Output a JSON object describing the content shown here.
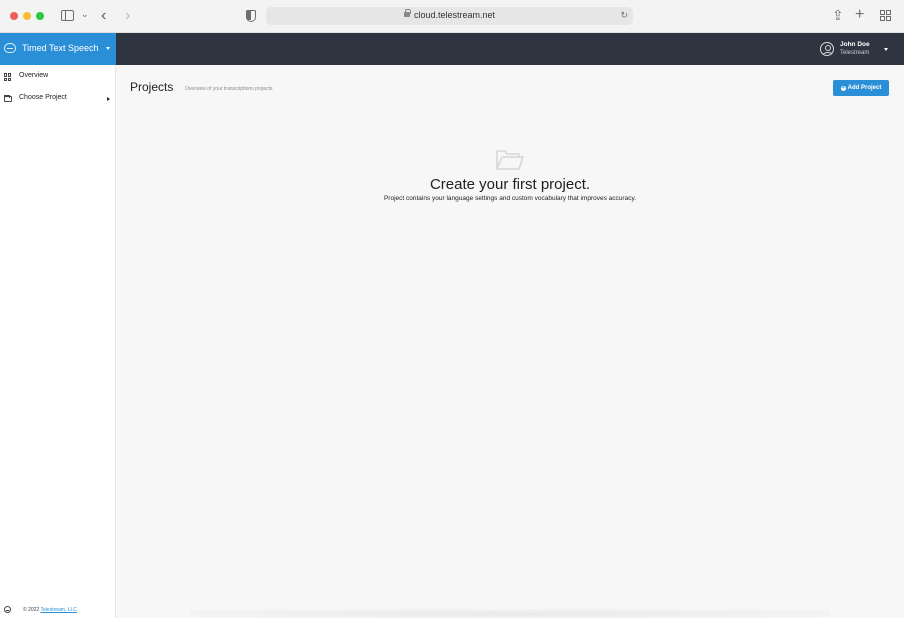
{
  "browser": {
    "url": "cloud.telestream.net"
  },
  "app": {
    "brand_title": "Timed Text Speech",
    "user_name": "John Doe",
    "user_org": "Telestream",
    "accent_color": "#2b8fd8",
    "header_color": "#2e3440"
  },
  "sidebar": {
    "items": [
      {
        "label": "Overview",
        "icon": "grid-icon"
      },
      {
        "label": "Choose Project",
        "icon": "folder-icon"
      }
    ],
    "footer_copyright": "© 2022",
    "footer_link": "Telestream, LLC"
  },
  "main": {
    "title": "Projects",
    "subtitle": "Overview of your transcriptions projects",
    "add_button_label": "Add Project",
    "empty_title": "Create your first project.",
    "empty_description": "Project contains your language settings and custom vocabulary that improves accuracy."
  }
}
